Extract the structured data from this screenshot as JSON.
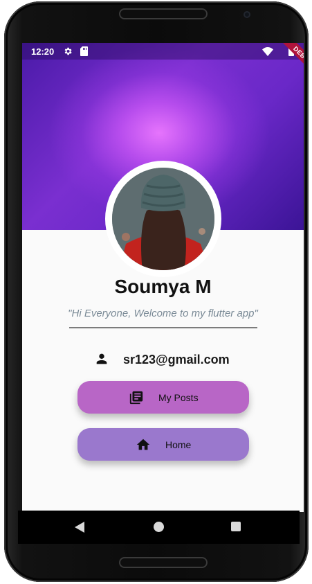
{
  "status_bar": {
    "time": "12:20",
    "icons": [
      "gear-icon",
      "sd-card-icon",
      "wifi-icon",
      "battery-icon"
    ],
    "debug_label": "DEBUG"
  },
  "profile": {
    "name": "Soumya M",
    "quote": "\"Hi Everyone, Welcome to my flutter app\"",
    "email": "sr123@gmail.com",
    "email_icon": "person-icon"
  },
  "buttons": {
    "my_posts": {
      "label": "My Posts",
      "icon": "article-icon",
      "color": "#b866c6"
    },
    "home": {
      "label": "Home",
      "icon": "home-icon",
      "color": "#9a78cd"
    }
  },
  "nav": {
    "icons": [
      "back-icon",
      "home-circle-icon",
      "recents-icon"
    ]
  },
  "colors": {
    "banner_accent": "#7a2fd0",
    "screen_bg": "#fafafa",
    "debug_ribbon": "#b0133b"
  }
}
